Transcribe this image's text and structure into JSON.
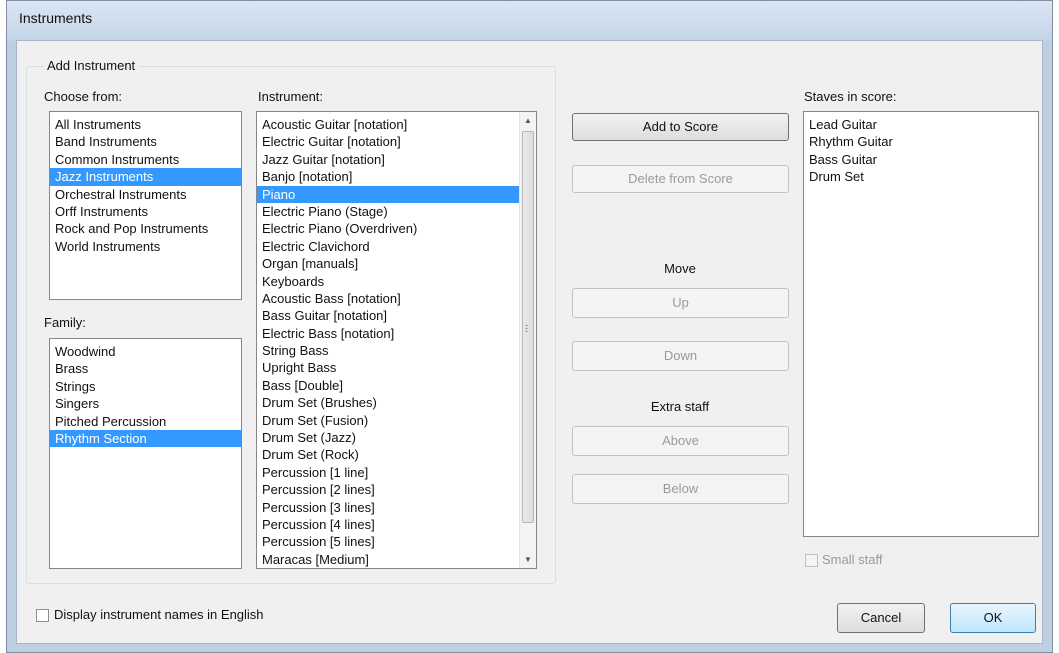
{
  "window": {
    "title": "Instruments"
  },
  "add_instrument": {
    "group_label": "Add Instrument",
    "choose_from": {
      "label": "Choose from:",
      "items": [
        "All Instruments",
        "Band Instruments",
        "Common Instruments",
        "Jazz Instruments",
        "Orchestral Instruments",
        "Orff Instruments",
        "Rock and Pop Instruments",
        "World Instruments"
      ],
      "selected_index": 3
    },
    "family": {
      "label": "Family:",
      "items": [
        "Woodwind",
        "Brass",
        "Strings",
        "Singers",
        "Pitched Percussion",
        "Rhythm Section"
      ],
      "selected_index": 5
    },
    "instrument": {
      "label": "Instrument:",
      "items": [
        "Acoustic Guitar [notation]",
        "Electric Guitar [notation]",
        "Jazz Guitar [notation]",
        "Banjo [notation]",
        "Piano",
        "Electric Piano (Stage)",
        "Electric Piano (Overdriven)",
        "Electric Clavichord",
        "Organ [manuals]",
        "Keyboards",
        "Acoustic Bass [notation]",
        "Bass Guitar [notation]",
        "Electric Bass [notation]",
        "String Bass",
        "Upright Bass",
        "Bass [Double]",
        "Drum Set (Brushes)",
        "Drum Set (Fusion)",
        "Drum Set (Jazz)",
        "Drum Set (Rock)",
        "Percussion [1 line]",
        "Percussion [2 lines]",
        "Percussion [3 lines]",
        "Percussion [4 lines]",
        "Percussion [5 lines]",
        "Maracas [Medium]"
      ],
      "selected_index": 4
    }
  },
  "actions": {
    "add_to_score": "Add to Score",
    "delete_from_score": "Delete from Score",
    "move_label": "Move",
    "up": "Up",
    "down": "Down",
    "extra_staff_label": "Extra staff",
    "above": "Above",
    "below": "Below"
  },
  "staves": {
    "label": "Staves in score:",
    "items": [
      "Lead Guitar",
      "Rhythm Guitar",
      "Bass Guitar",
      "Drum Set"
    ],
    "small_staff_label": "Small staff"
  },
  "footer": {
    "english_names_label": "Display instrument names in English",
    "cancel": "Cancel",
    "ok": "OK"
  },
  "colors": {
    "selection": "#3399ff",
    "window_frame": "#bfcfe2",
    "dialog_bg": "#f0f0f0"
  }
}
